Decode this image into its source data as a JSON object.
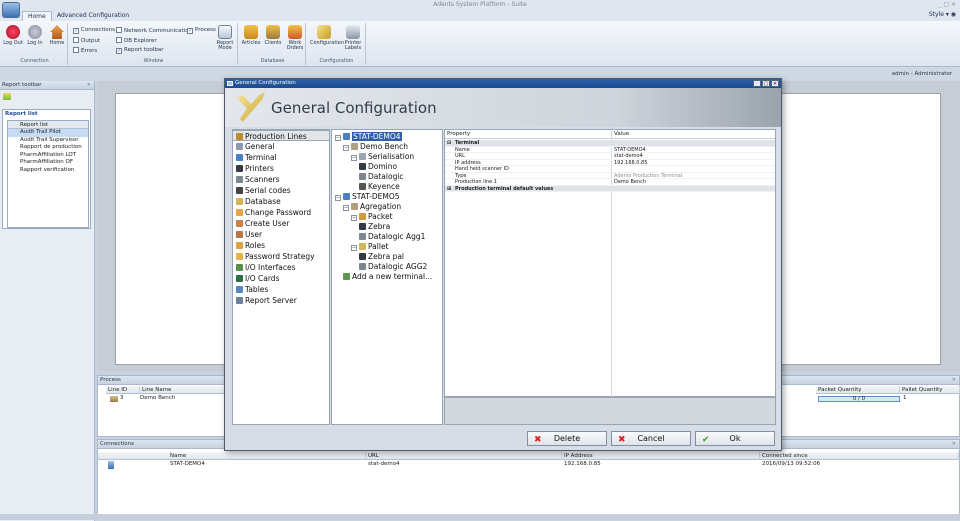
{
  "window": {
    "title": "Adents System Platform - Suite",
    "controls": "_ ▢ ✕"
  },
  "tabs": [
    {
      "label": "Home"
    },
    {
      "label": "Advanced Configuration"
    }
  ],
  "style_menu": "Style ▾ ◉",
  "ribbon": {
    "connection": {
      "label": "Connection",
      "buttons": [
        "Log Out",
        "Log In",
        "Home"
      ]
    },
    "window": {
      "label": "Window",
      "checks": [
        {
          "label": "Connections",
          "checked": true
        },
        {
          "label": "Network Communication",
          "checked": false
        },
        {
          "label": "Process",
          "checked": true
        },
        {
          "label": "Output",
          "checked": false
        },
        {
          "label": "DB Explorer",
          "checked": false
        },
        {
          "label": "Errors",
          "checked": false
        },
        {
          "label": "Report toolbar",
          "checked": true
        }
      ],
      "report_mode": "Report Mode"
    },
    "database": {
      "label": "Database",
      "buttons": [
        "Articles",
        "Clients",
        "Work Orders"
      ]
    },
    "configuration": {
      "label": "Configuration",
      "buttons": [
        "Configuration",
        "Printer Labels"
      ]
    }
  },
  "user": "admin - Administrator",
  "left_panel": {
    "title": "Report toolbar",
    "report_title": "Report list",
    "list_header": "Report list",
    "items": [
      {
        "label": "Audit Trail Pilot",
        "selected": true
      },
      {
        "label": "Audit Trail Supervisor",
        "selected": false
      },
      {
        "label": "Rapport de production",
        "selected": false
      },
      {
        "label": "PharmAffiliation LOT",
        "selected": false
      },
      {
        "label": "PharmAffiliation OF",
        "selected": false
      },
      {
        "label": "Rapport verification",
        "selected": false
      }
    ]
  },
  "process": {
    "title": "Process",
    "columns": [
      "Line ID",
      "Line Name",
      "Packet Quantity",
      "Pallet Quantity"
    ],
    "rows": [
      {
        "line_id": "3",
        "line_name": "Demo Bench",
        "packet_qty": "0 / 0",
        "pallet_qty": "1"
      }
    ]
  },
  "connections": {
    "title": "Connections",
    "columns": [
      "Name",
      "URL",
      "IP Address",
      "Connected since"
    ],
    "rows": [
      {
        "name": "STAT-DEMO4",
        "url": "stat-demo4",
        "ip": "192.168.0.85",
        "since": "2016/09/13 09:52:06"
      }
    ]
  },
  "dialog": {
    "title": "General Configuration",
    "header": "General Configuration",
    "nav": [
      {
        "label": "Production Lines",
        "selected": true,
        "color": "#c08a2e"
      },
      {
        "label": "General",
        "color": "#8a9bb0"
      },
      {
        "label": "Terminal",
        "color": "#4a7fc6"
      },
      {
        "label": "Printers",
        "color": "#333a44"
      },
      {
        "label": "Scanners",
        "color": "#7d8792"
      },
      {
        "label": "Serial codes",
        "color": "#444"
      },
      {
        "label": "Database",
        "color": "#d4b45a"
      },
      {
        "label": "Change Password",
        "color": "#e0a93a"
      },
      {
        "label": "Create User",
        "color": "#c7824a"
      },
      {
        "label": "User",
        "color": "#b9764a"
      },
      {
        "label": "Roles",
        "color": "#d9a445"
      },
      {
        "label": "Password Strategy",
        "color": "#e3b34c"
      },
      {
        "label": "I/O Interfaces",
        "color": "#5a8f4a"
      },
      {
        "label": "I/O Cards",
        "color": "#2f6e45"
      },
      {
        "label": "Tables",
        "color": "#5a86c0"
      },
      {
        "label": "Report Server",
        "color": "#6a7f99"
      }
    ],
    "tree": [
      {
        "label": "STAT-DEMO4",
        "level": 0,
        "expander": "⊟",
        "selected": true,
        "color": "#4a7fc6"
      },
      {
        "label": "Demo Bench",
        "level": 1,
        "expander": "⊟",
        "color": "#b0a080"
      },
      {
        "label": "Serialisation",
        "level": 2,
        "expander": "⊟",
        "color": "#9aa3b0"
      },
      {
        "label": "Domino",
        "level": 3,
        "color": "#333a44"
      },
      {
        "label": "Datalogic",
        "level": 3,
        "color": "#7d8792"
      },
      {
        "label": "Keyence",
        "level": 3,
        "color": "#555"
      },
      {
        "label": "STAT-DEMO5",
        "level": 0,
        "expander": "⊟",
        "color": "#4a7fc6"
      },
      {
        "label": "Agregation",
        "level": 1,
        "expander": "⊟",
        "color": "#b0a080"
      },
      {
        "label": "Packet",
        "level": 2,
        "expander": "⊟",
        "color": "#d49a3a"
      },
      {
        "label": "Zebra",
        "level": 3,
        "color": "#333a44"
      },
      {
        "label": "Datalogic Agg1",
        "level": 3,
        "color": "#7d8792"
      },
      {
        "label": "Pallet",
        "level": 2,
        "expander": "⊟",
        "color": "#d4b45a"
      },
      {
        "label": "Zebra pal",
        "level": 3,
        "color": "#333a44"
      },
      {
        "label": "Datalogic AGG2",
        "level": 3,
        "color": "#7d8792"
      },
      {
        "label": "Add a new terminal...",
        "level": 1,
        "color": "#5a9a4a"
      }
    ],
    "property_grid": {
      "col_property": "Property",
      "col_value": "Value",
      "rows": [
        {
          "key": "Terminal",
          "value": "",
          "category": true,
          "expander": "⊟"
        },
        {
          "key": "Name",
          "value": "STAT-DEMO4"
        },
        {
          "key": "URL",
          "value": "stat-demo4"
        },
        {
          "key": "IP address",
          "value": "192.168.0.85"
        },
        {
          "key": "Hand held scanner ID",
          "value": ""
        },
        {
          "key": "Type",
          "value": "Adents Production Terminal",
          "muted": true
        },
        {
          "key": "Production line 1",
          "value": "Demo Bench"
        },
        {
          "key": "Production terminal default values",
          "value": "",
          "category": true,
          "expander": "⊞"
        }
      ]
    },
    "buttons": {
      "delete": "Delete",
      "cancel": "Cancel",
      "ok": "Ok"
    }
  }
}
